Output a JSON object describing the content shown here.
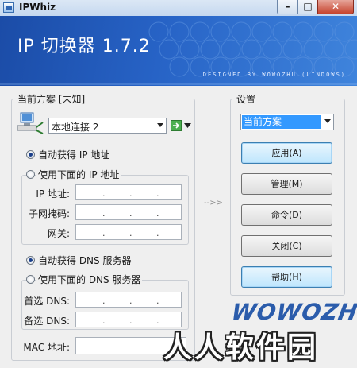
{
  "window": {
    "title": "IPWhiz",
    "min_label": "–",
    "max_label": "□",
    "close_label": "✕"
  },
  "banner": {
    "title": "IP 切换器 1.7.2",
    "subtitle": "DESIGNED BY WOWOZHU (LINDOWS)"
  },
  "left": {
    "group_label": "当前方案 [未知]",
    "connection_value": "本地连接 2",
    "radio_auto_ip": "自动获得 IP 地址",
    "radio_manual_ip": "使用下面的 IP 地址",
    "ip_label": "IP 地址:",
    "mask_label": "子网掩码:",
    "gateway_label": "网关:",
    "radio_auto_dns": "自动获得 DNS 服务器",
    "radio_manual_dns": "使用下面的 DNS 服务器",
    "dns1_label": "首选 DNS:",
    "dns2_label": "备选 DNS:",
    "mac_label": "MAC 地址:",
    "ip_dot": "."
  },
  "right": {
    "group_label": "设置",
    "scheme_value": "当前方案",
    "buttons": [
      "应用(A)",
      "管理(M)",
      "命令(D)",
      "关闭(C)",
      "帮助(H)"
    ]
  },
  "arrow_text": "-->>",
  "watermark_logo": "WOWOZHU",
  "watermark_site": "人人软件园"
}
